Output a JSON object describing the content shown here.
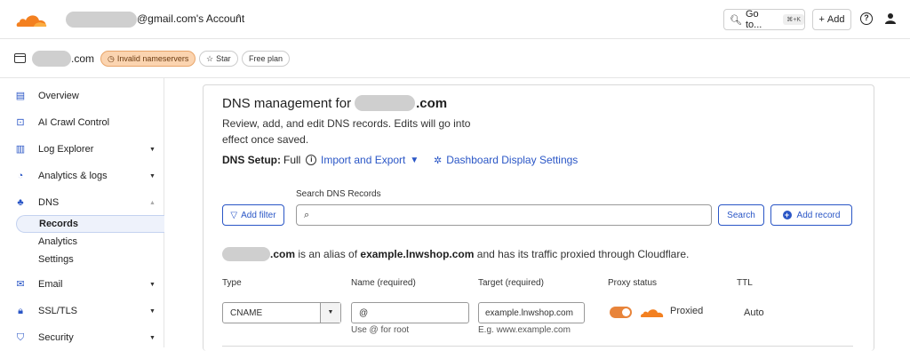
{
  "topbar": {
    "account_label": "@gmail.com's Account",
    "goto_label": "Go to...",
    "goto_shortcut": "⌘+K",
    "add_label": "Add",
    "help_glyph": "?"
  },
  "zone": {
    "name_suffix": ".com",
    "invalid_badge": "Invalid nameservers",
    "star_label": "Star",
    "plan_label": "Free plan"
  },
  "sidebar": {
    "items": [
      {
        "label": "Overview",
        "icon": "clipboard-icon"
      },
      {
        "label": "AI Crawl Control",
        "icon": "bot-icon"
      },
      {
        "label": "Log Explorer",
        "icon": "document-search-icon"
      },
      {
        "label": "Analytics & logs",
        "icon": "pie-chart-icon"
      },
      {
        "label": "DNS",
        "icon": "network-icon"
      },
      {
        "label": "Email",
        "icon": "envelope-icon"
      },
      {
        "label": "SSL/TLS",
        "icon": "lock-icon"
      },
      {
        "label": "Security",
        "icon": "shield-icon"
      }
    ],
    "dns_sub": [
      "Records",
      "Analytics",
      "Settings"
    ]
  },
  "main": {
    "title_prefix": "DNS management for",
    "title_suffix": ".com",
    "description": "Review, add, and edit DNS records. Edits will go into effect once saved.",
    "setup_label": "DNS Setup:",
    "setup_value": "Full",
    "import_export": "Import and Export",
    "display_settings": "Dashboard Display Settings",
    "search_label": "Search DNS Records",
    "add_filter": "Add filter",
    "search_button": "Search",
    "add_record": "Add record",
    "alias_suffix": ".com",
    "alias_middle": " is an alias of ",
    "alias_target": "example.lnwshop.com",
    "alias_end": " and has its traffic proxied through Cloudflare."
  },
  "form": {
    "headers": {
      "type": "Type",
      "name": "Name (required)",
      "target": "Target (required)",
      "proxy": "Proxy status",
      "ttl": "TTL"
    },
    "type_value": "CNAME",
    "name_value": "@",
    "target_value": "example.lnwshop.com",
    "name_hint": "Use @ for root",
    "target_hint": "E.g. www.example.com",
    "proxy_value": "Proxied",
    "proxy_on": true,
    "ttl_value": "Auto"
  },
  "colors": {
    "accent": "#2a56c6",
    "cloudflare_orange": "#f38020",
    "warning_badge": "#fbd4b0"
  }
}
